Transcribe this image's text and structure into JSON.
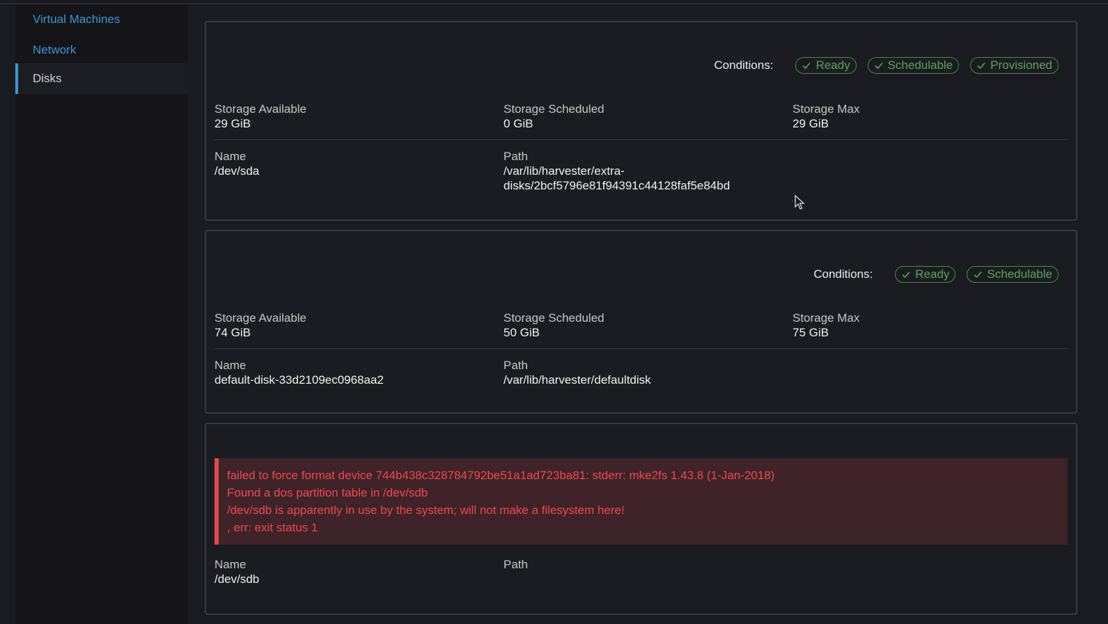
{
  "sidebar": {
    "items": [
      {
        "label": "Virtual Machines",
        "active": false
      },
      {
        "label": "Network",
        "active": false
      },
      {
        "label": "Disks",
        "active": true
      }
    ]
  },
  "labels": {
    "conditions": "Conditions:",
    "storage_available": "Storage Available",
    "storage_scheduled": "Storage Scheduled",
    "storage_max": "Storage Max",
    "name": "Name",
    "path": "Path"
  },
  "disks": [
    {
      "conditions": [
        "Ready",
        "Schedulable",
        "Provisioned"
      ],
      "storage_available": "29 GiB",
      "storage_scheduled": "0 GiB",
      "storage_max": "29 GiB",
      "name": "/dev/sda",
      "path_line1": "/var/lib/harvester/extra-",
      "path_line2": "disks/2bcf5796e81f94391c44128faf5e84bd"
    },
    {
      "conditions": [
        "Ready",
        "Schedulable"
      ],
      "storage_available": "74 GiB",
      "storage_scheduled": "50 GiB",
      "storage_max": "75 GiB",
      "name": "default-disk-33d2109ec0968aa2",
      "path": "/var/lib/harvester/defaultdisk"
    },
    {
      "error_lines": [
        "failed to force format device 744b438c328784792be51a1ad723ba81: stderr: mke2fs 1.43.8 (1-Jan-2018)",
        "Found a dos partition table in /dev/sdb",
        "/dev/sdb is apparently in use by the system; will not make a filesystem here!",
        ", err: exit status 1"
      ],
      "name": "/dev/sdb",
      "path": ""
    }
  ],
  "colors": {
    "accent": "#3d98d3",
    "success": "#5aa55a",
    "error": "#f0474e",
    "error_bg": "#3e2428"
  }
}
